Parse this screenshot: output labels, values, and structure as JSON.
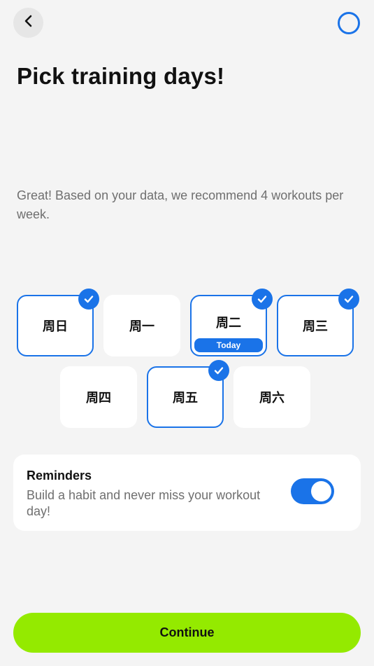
{
  "header": {
    "back_icon": "chevron-left-icon",
    "progress_icon": "progress-ring-icon",
    "accent_color": "#1a73e8"
  },
  "title": "Pick training days!",
  "subtitle": "Great! Based on your data, we recommend 4 workouts per week.",
  "days": [
    {
      "label": "周日",
      "selected": true
    },
    {
      "label": "周一",
      "selected": false
    },
    {
      "label": "周二",
      "selected": true,
      "badge": "Today"
    },
    {
      "label": "周三",
      "selected": true
    },
    {
      "label": "周四",
      "selected": false
    },
    {
      "label": "周五",
      "selected": true
    },
    {
      "label": "周六",
      "selected": false
    }
  ],
  "reminders": {
    "title": "Reminders",
    "description": "Build a habit and never miss your workout day!",
    "enabled": true
  },
  "continue_label": "Continue",
  "continue_color": "#94ea00"
}
